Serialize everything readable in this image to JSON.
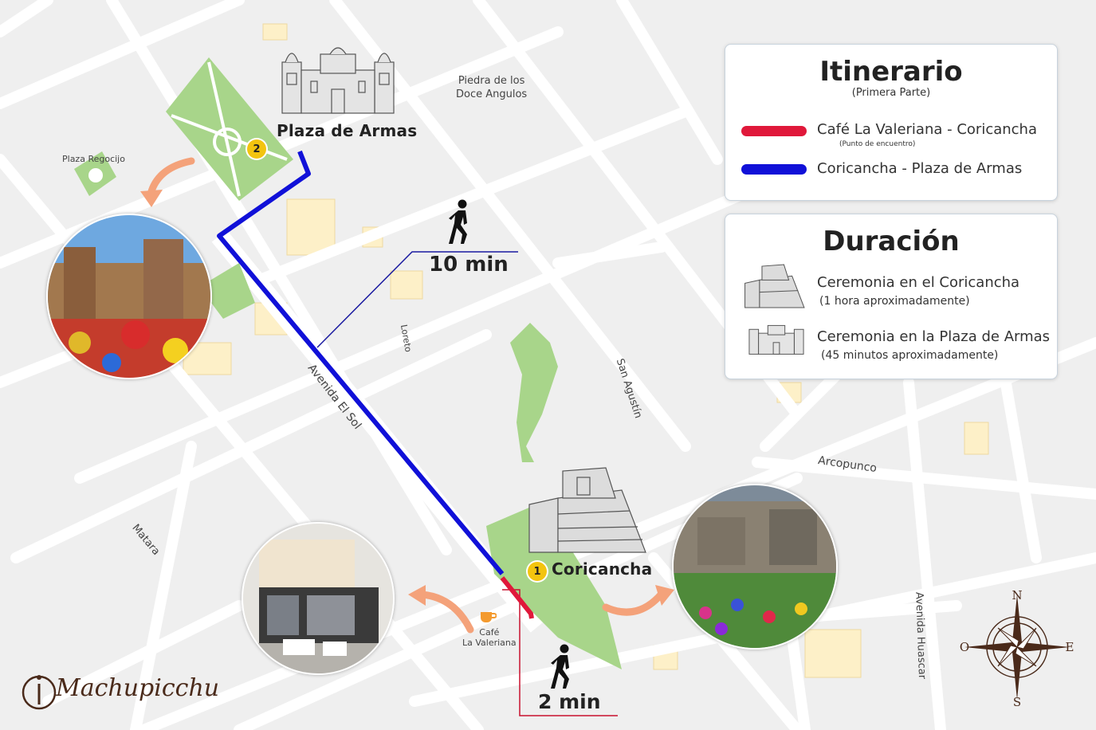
{
  "colors": {
    "route_red": "#e0183a",
    "route_blue": "#1010d8",
    "park_green": "#a8d58a",
    "building_yellow": "#fdf0c8",
    "arrow_orange": "#f4a27a",
    "badge_yellow": "#f3c40f"
  },
  "streets": {
    "piedra": [
      "Piedra de los",
      "Doce Angulos"
    ],
    "plaza_regocijo": "Plaza Regocijo",
    "loreto": "Loreto",
    "avenida_el_sol": "Avenida El Sol",
    "san_agustin": "San Agustín",
    "arcopunco": "Arcopunco",
    "matara": "Matara",
    "avenida_huascar": "Avenida Huascar"
  },
  "places": {
    "plaza_de_armas": "Plaza de Armas",
    "coricancha": "Coricancha",
    "cafe": [
      "Café",
      "La Valeriana"
    ],
    "cafe_icon": "coffee-cup-icon"
  },
  "markers": {
    "stop_1": "1",
    "stop_2": "2"
  },
  "walk": {
    "long": "10 min",
    "short": "2 min",
    "icon": "walking-person-icon"
  },
  "itinerary": {
    "title": "Itinerario",
    "subtitle": "(Primera Parte)",
    "items": [
      {
        "label": "Café La Valeriana - Coricancha",
        "note": "(Punto de encuentro)",
        "color": "#e0183a"
      },
      {
        "label": "Coricancha - Plaza de Armas",
        "note": "",
        "color": "#1010d8"
      }
    ]
  },
  "duration": {
    "title": "Duración",
    "items": [
      {
        "label": "Ceremonia en el Coricancha",
        "detail": "(1 hora aproximadamente)",
        "icon": "coricancha-temple-icon"
      },
      {
        "label": "Ceremonia en la Plaza de Armas",
        "detail": "(45 minutos aproximadamente)",
        "icon": "cathedral-icon"
      }
    ]
  },
  "compass": {
    "n": "N",
    "s": "S",
    "e": "E",
    "o": "O"
  },
  "brand": {
    "text": "Machupicchu"
  }
}
